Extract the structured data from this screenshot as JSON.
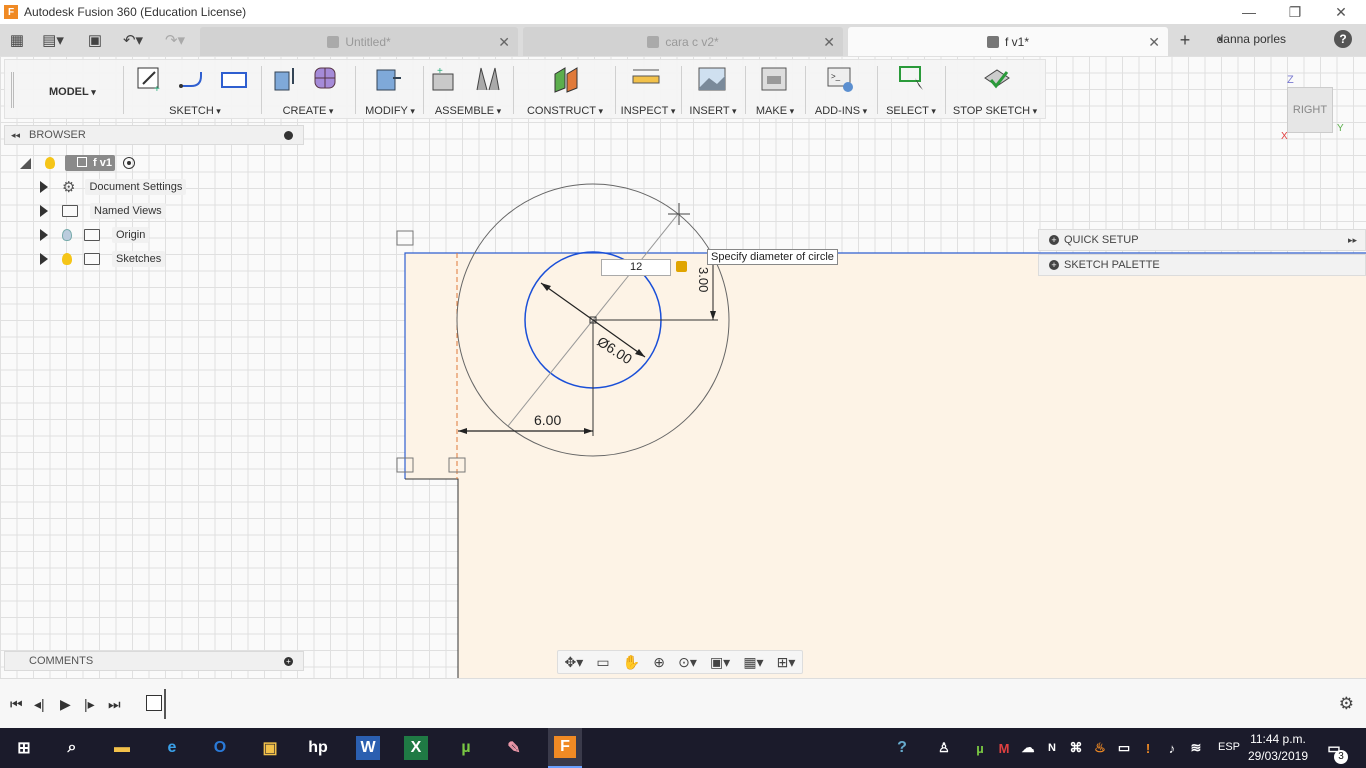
{
  "window": {
    "title": "Autodesk Fusion 360 (Education License)",
    "app_letter": "F"
  },
  "tabs": [
    {
      "label": "Untitled*"
    },
    {
      "label": "cara c v2*"
    },
    {
      "label": "f v1*"
    }
  ],
  "user": {
    "name": "danna porles",
    "help": "?"
  },
  "toolbar": {
    "workspace": "MODEL",
    "groups": [
      "SKETCH",
      "CREATE",
      "MODIFY",
      "ASSEMBLE",
      "CONSTRUCT",
      "INSPECT",
      "INSERT",
      "MAKE",
      "ADD-INS",
      "SELECT",
      "STOP SKETCH"
    ]
  },
  "browser": {
    "title": "BROWSER",
    "root": "f v1",
    "items": [
      {
        "label": "Document Settings",
        "icon": "gear-icon"
      },
      {
        "label": "Named Views",
        "icon": "folder-icon"
      },
      {
        "label": "Origin",
        "icon": "folder-icon"
      },
      {
        "label": "Sketches",
        "icon": "folder-icon"
      }
    ]
  },
  "comments": {
    "title": "COMMENTS"
  },
  "right_panel": {
    "quick_setup": "QUICK SETUP",
    "sketch_palette": "SKETCH PALETTE"
  },
  "viewcube": {
    "face": "RIGHT",
    "axis_z": "Z",
    "axis_y": "Y",
    "axis_x": "X"
  },
  "sketch": {
    "tooltip": "Specify diameter of circle",
    "diameter_input": "12",
    "dim_diameter": "Ø6.00",
    "dim_horizontal": "6.00",
    "dim_vertical": "3.00"
  },
  "colors": {
    "sketch_blue": "#1a4fd8",
    "profile_fill": "#fdf3e6",
    "accent": "#f08a24"
  },
  "taskbar": {
    "lang": "ESP",
    "time": "11:44 p.m.",
    "date": "29/03/2019",
    "notifications": "3"
  }
}
